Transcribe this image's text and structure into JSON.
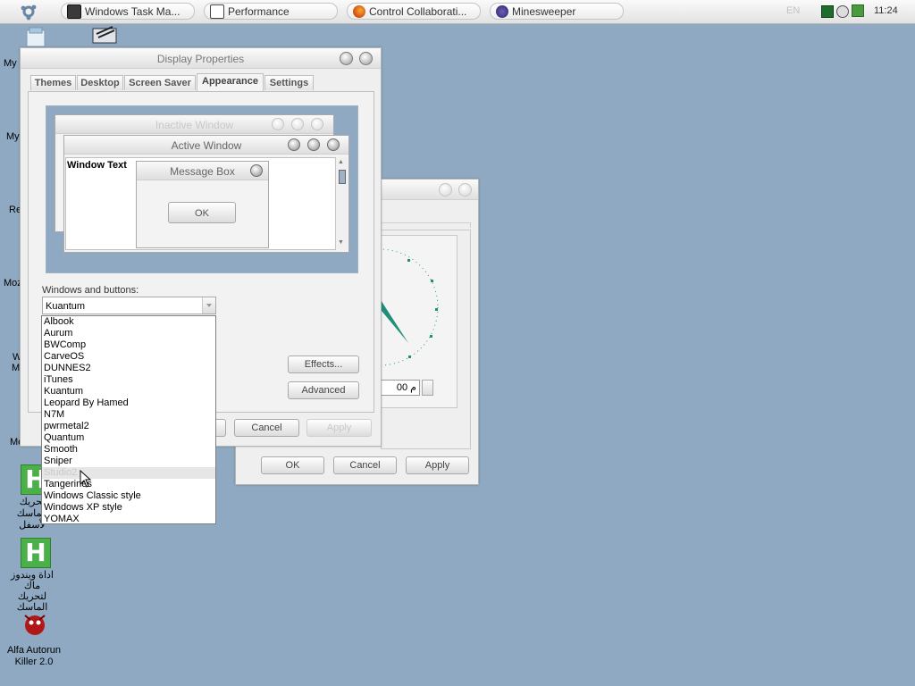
{
  "taskbar": {
    "tasks": [
      {
        "label": "Windows Task Ma..."
      },
      {
        "label": "Performance"
      },
      {
        "label": "Control Collaborati..."
      },
      {
        "label": "Minesweeper"
      }
    ],
    "language": "EN",
    "clock": "11:24"
  },
  "desktop": {
    "icon_labels": [
      "My I",
      "My",
      "Re",
      "Moz",
      "W",
      "M",
      "Me"
    ],
    "hacker_icon_1": [
      "تحريك الماسك",
      "لأسفل"
    ],
    "hacker_icon_2": [
      "اداة ويندوز ماك",
      "لتحريك الماسك",
      "..."
    ],
    "autorun_icon": [
      "Alfa Autorun",
      "Killer 2.0"
    ]
  },
  "back_window": {
    "ok": "OK",
    "cancel": "Cancel",
    "apply": "Apply",
    "time_value": "م 00"
  },
  "display_window": {
    "title": "Display Properties",
    "tabs": [
      "Themes",
      "Desktop",
      "Screen Saver",
      "Appearance",
      "Settings"
    ],
    "active_tab": "Appearance",
    "preview": {
      "inactive_title": "Inactive Window",
      "active_title": "Active Window",
      "window_text": "Window Text",
      "message_box_title": "Message Box",
      "ok": "OK"
    },
    "windows_buttons_label": "Windows and buttons:",
    "selected_style": "Kuantum",
    "style_options": [
      "Albook",
      "Aurum",
      "BWComp",
      "CarveOS",
      "DUNNES2",
      "iTunes",
      "Kuantum",
      "Leopard By Hamed",
      "N7M",
      "pwrmetal2",
      "Quantum",
      "Smooth",
      "Sniper",
      "Studio2",
      "Tangerines",
      "Windows Classic style",
      "Windows XP style",
      "YOMAX"
    ],
    "hovered_option": "Studio2",
    "effects": "Effects...",
    "advanced": "Advanced",
    "cancel": "Cancel",
    "apply": "Apply"
  },
  "colors": {
    "desktop": "#8ea9c1",
    "clock_hand": "#1f8f7a"
  }
}
